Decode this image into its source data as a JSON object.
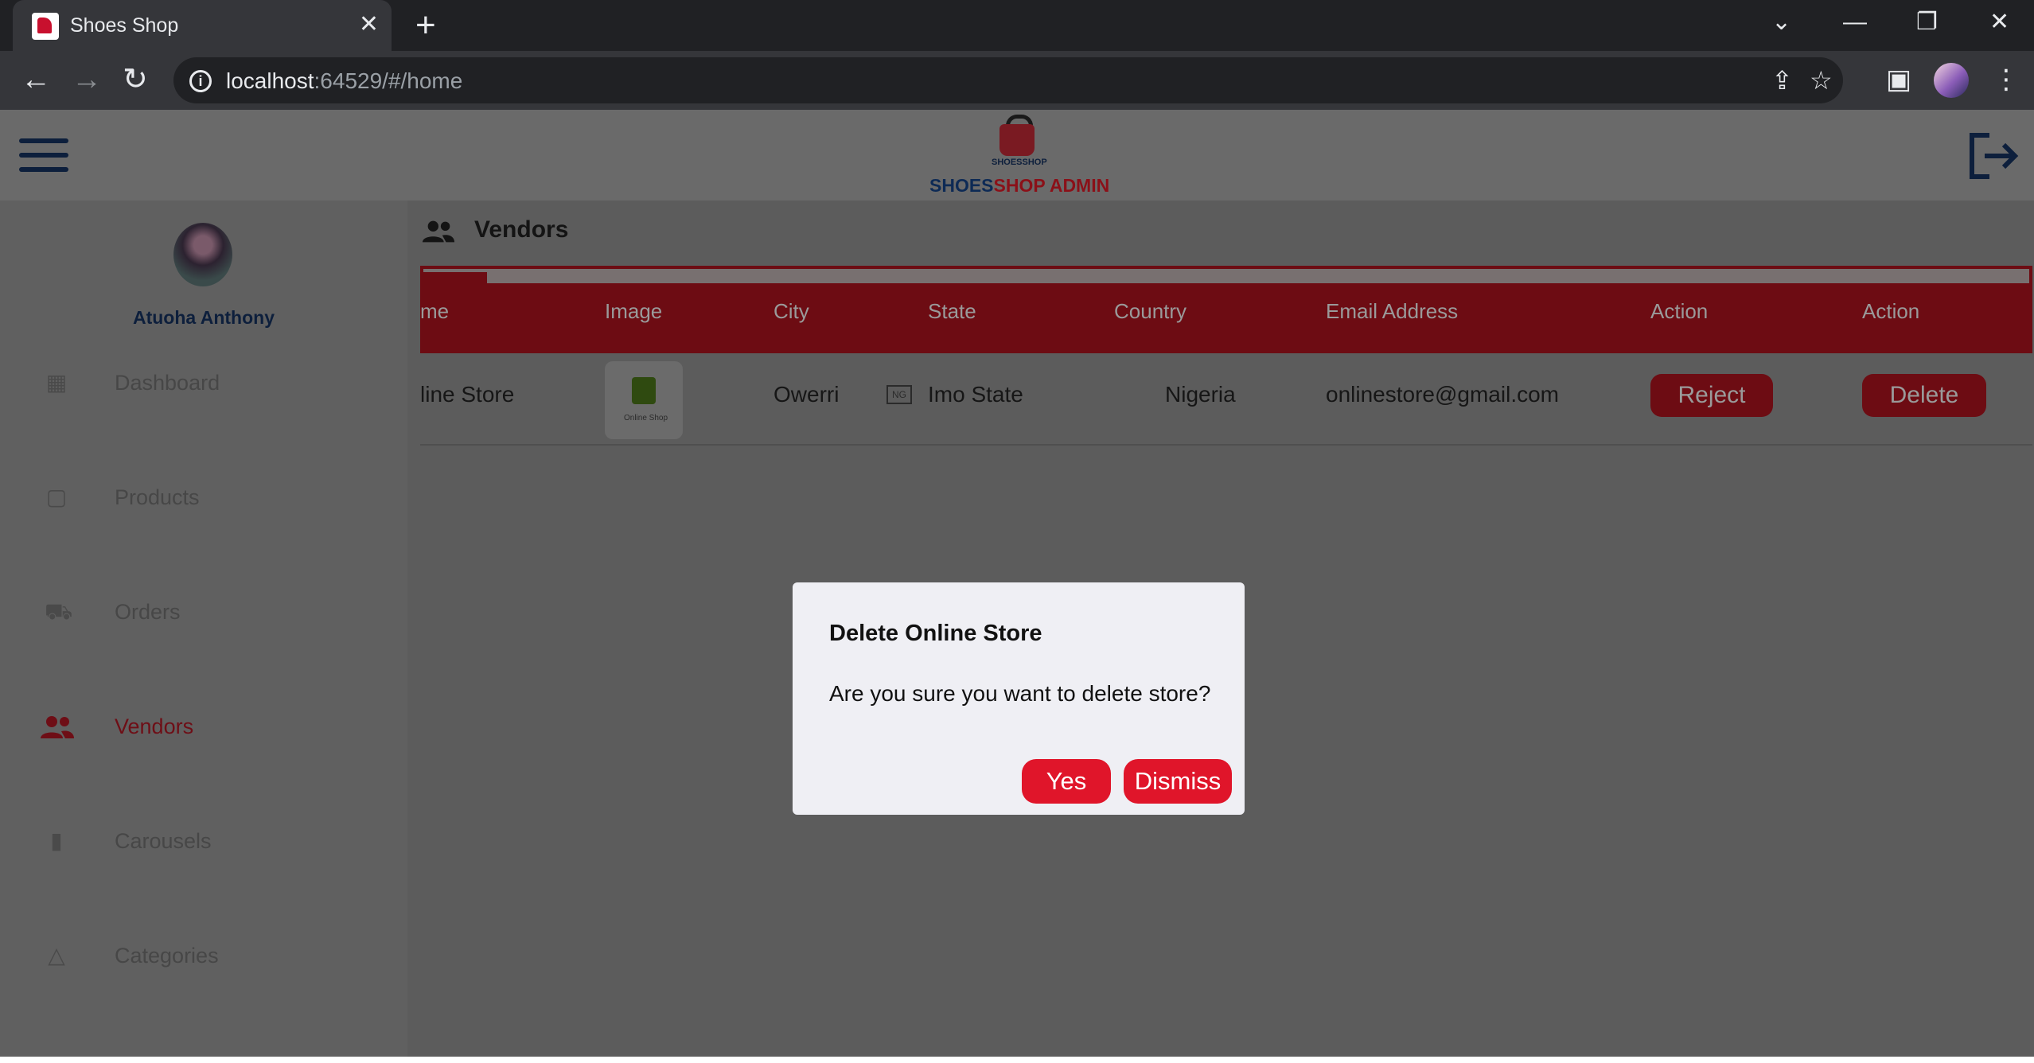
{
  "browser": {
    "tab_title": "Shoes Shop",
    "url_host": "localhost",
    "url_rest": ":64529/#/home"
  },
  "app": {
    "brand_part1": "SHOES",
    "brand_part2": "SHOP ADMIN",
    "logo_text": "SHOESSHOP"
  },
  "sidebar": {
    "user_name": "Atuoha Anthony",
    "items": [
      {
        "label": "Dashboard",
        "icon": "dashboard-icon"
      },
      {
        "label": "Products",
        "icon": "bag-icon"
      },
      {
        "label": "Orders",
        "icon": "cart-icon"
      },
      {
        "label": "Vendors",
        "icon": "people-icon",
        "active": true
      },
      {
        "label": "Carousels",
        "icon": "carousel-icon"
      },
      {
        "label": "Categories",
        "icon": "categories-icon"
      }
    ]
  },
  "main": {
    "section_title": "Vendors",
    "columns": [
      "me",
      "Image",
      "City",
      "State",
      "Country",
      "Email Address",
      "Action",
      "Action"
    ],
    "row": {
      "name": "line Store",
      "image_caption": "Online Shop",
      "city": "Owerri",
      "state": "Imo State",
      "country": "Nigeria",
      "email": "onlinestore@gmail.com",
      "reject_label": "Reject",
      "delete_label": "Delete"
    }
  },
  "dialog": {
    "title": "Delete Online Store",
    "message": "Are you sure you want to delete store?",
    "yes_label": "Yes",
    "dismiss_label": "Dismiss"
  },
  "colors": {
    "brand_red": "#e0152a",
    "brand_navy": "#0d1f3c"
  }
}
